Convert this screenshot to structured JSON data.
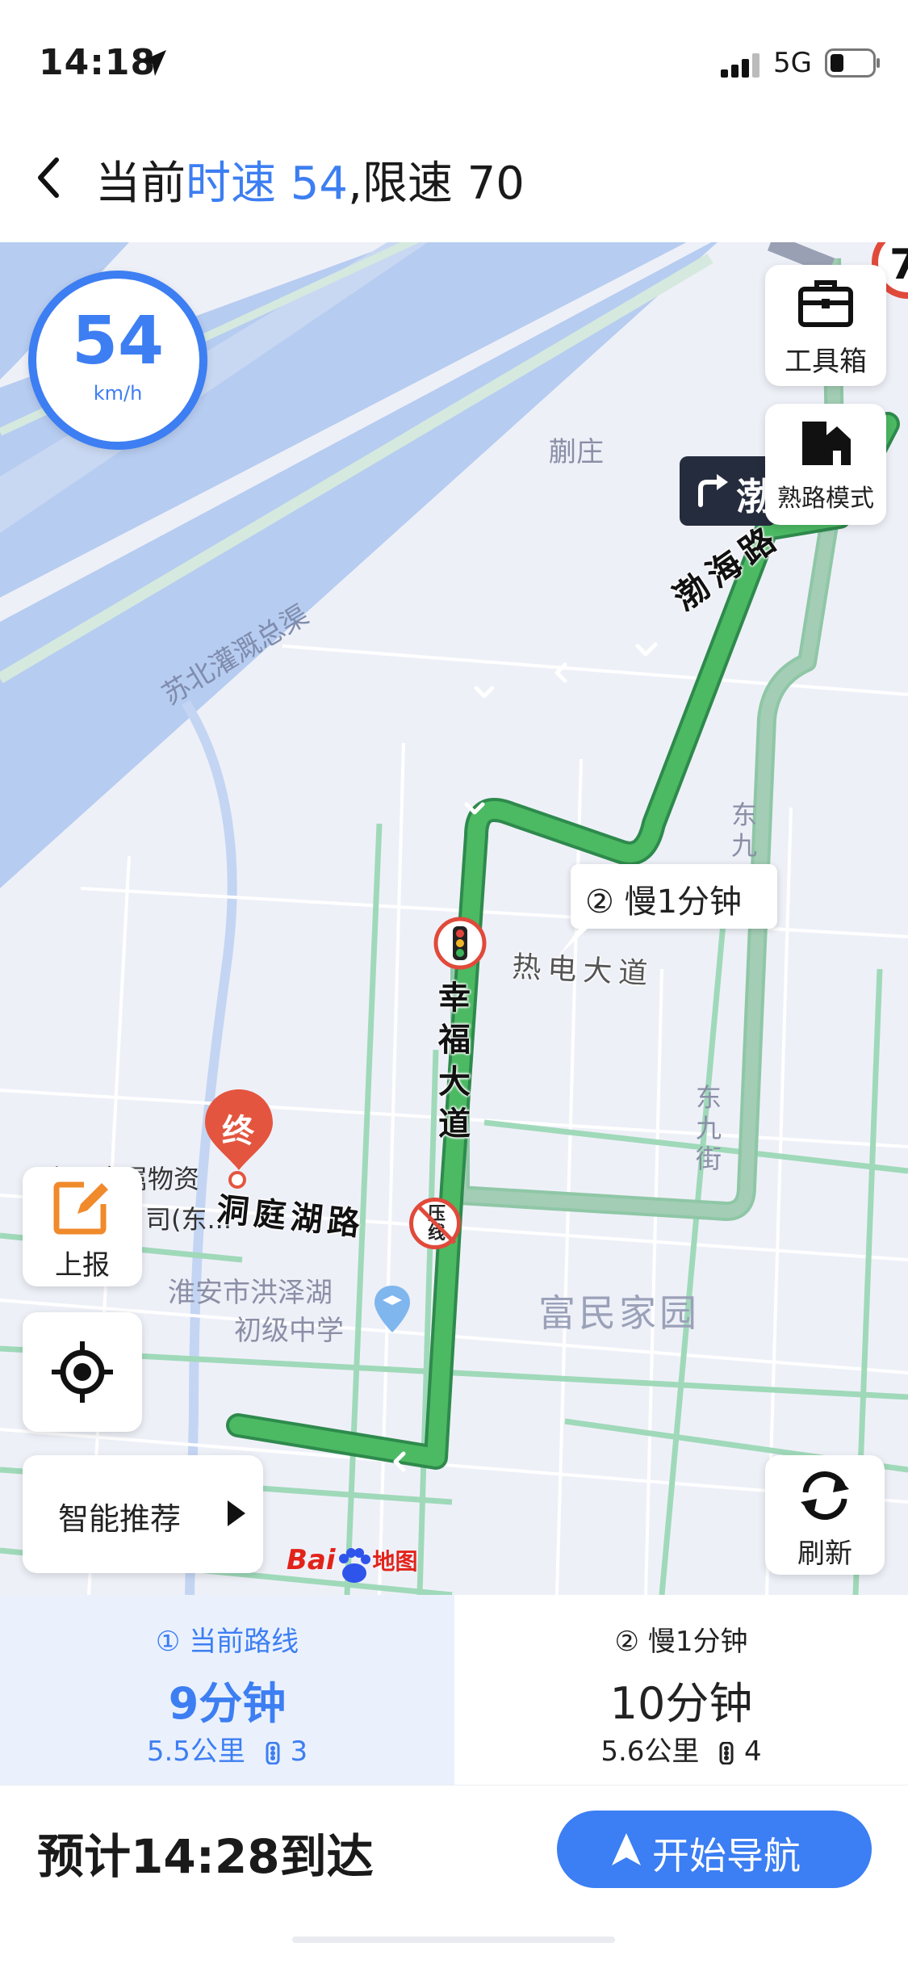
{
  "status_bar": {
    "time": "14:18",
    "network": "5G"
  },
  "header": {
    "prefix": "当前",
    "speed_text": "时速 54",
    "limit_text": ",限速 70"
  },
  "map": {
    "speed_badge": {
      "value": "54",
      "unit": "km/h"
    },
    "labels": {
      "village": "蒯庄",
      "canal": "苏北灌溉总渠",
      "residential": "富民家园",
      "school_line1": "淮安市洪泽湖",
      "school_line2": "初级中学",
      "poi_line1": "宇泽金属物资",
      "poi_line2": "司(东...",
      "street_east": "东九街",
      "street_east_top": "东九",
      "logo_text": "Bai",
      "logo_map": "地图"
    },
    "roads": {
      "bohai": "渤海路",
      "xingfu": "幸福大道",
      "dongting": "洞庭湖路",
      "redian": "热电大道"
    },
    "turn_sign": "渤",
    "callout": "② 慢1分钟",
    "end_marker": "终",
    "violation_marker": "压线",
    "edge_limit": "7"
  },
  "controls": {
    "toolbox": "工具箱",
    "familiar_mode": "熟路模式",
    "report": "上报",
    "smart_recommend": "智能推荐",
    "refresh": "刷新"
  },
  "routes": [
    {
      "title": "① 当前路线",
      "duration": "9分钟",
      "distance": "5.5公里",
      "lights": "3",
      "selected": true
    },
    {
      "title": "② 慢1分钟",
      "duration": "10分钟",
      "distance": "5.6公里",
      "lights": "4",
      "selected": false
    }
  ],
  "footer": {
    "eta": "预计14:28到达",
    "start_button": "开始导航"
  },
  "colors": {
    "accent": "#3d7ef2",
    "route_green": "#4cb963",
    "alt_route": "#a3cdb5",
    "water": "#b6ccf0"
  }
}
